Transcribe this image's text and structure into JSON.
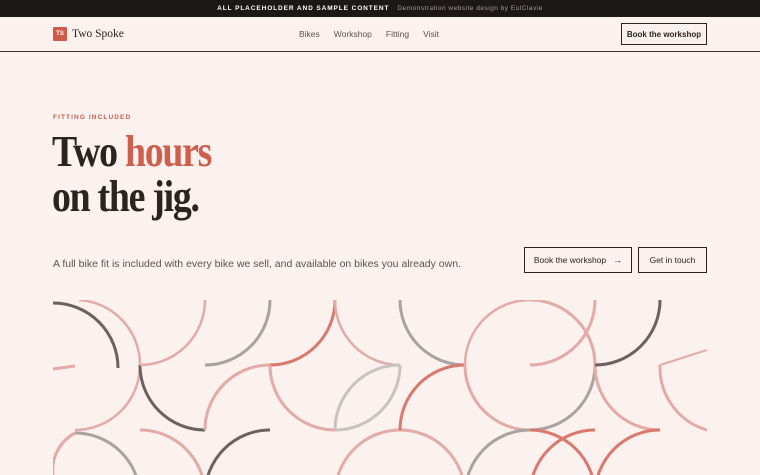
{
  "banner": {
    "notice": "ALL PLACEHOLDER AND SAMPLE CONTENT",
    "credit": "Demonstration website design by EulClavie"
  },
  "brand": {
    "mark": "TS",
    "name": "Two Spoke",
    "accent_color": "#d05a46"
  },
  "nav": {
    "links": [
      "Bikes",
      "Workshop",
      "Fitting",
      "Visit"
    ],
    "cta": "Book the workshop"
  },
  "hero": {
    "eyebrow": "FITTING INCLUDED",
    "title_plain": "Two",
    "title_accent": "hours",
    "title_line2": "on the jig.",
    "lead": "A full bike fit is included with every bike we sell, and available on bikes you already own.",
    "primary_cta": "Book the workshop",
    "primary_cta_icon": "arrow-right-icon",
    "secondary_cta": "Get in touch"
  },
  "pattern": {
    "colors": {
      "pink": "#e3aaa6",
      "dark": "#6b6160",
      "grey": "#a9a2a1",
      "light": "#c9c2c1",
      "red": "#d9786b"
    }
  }
}
